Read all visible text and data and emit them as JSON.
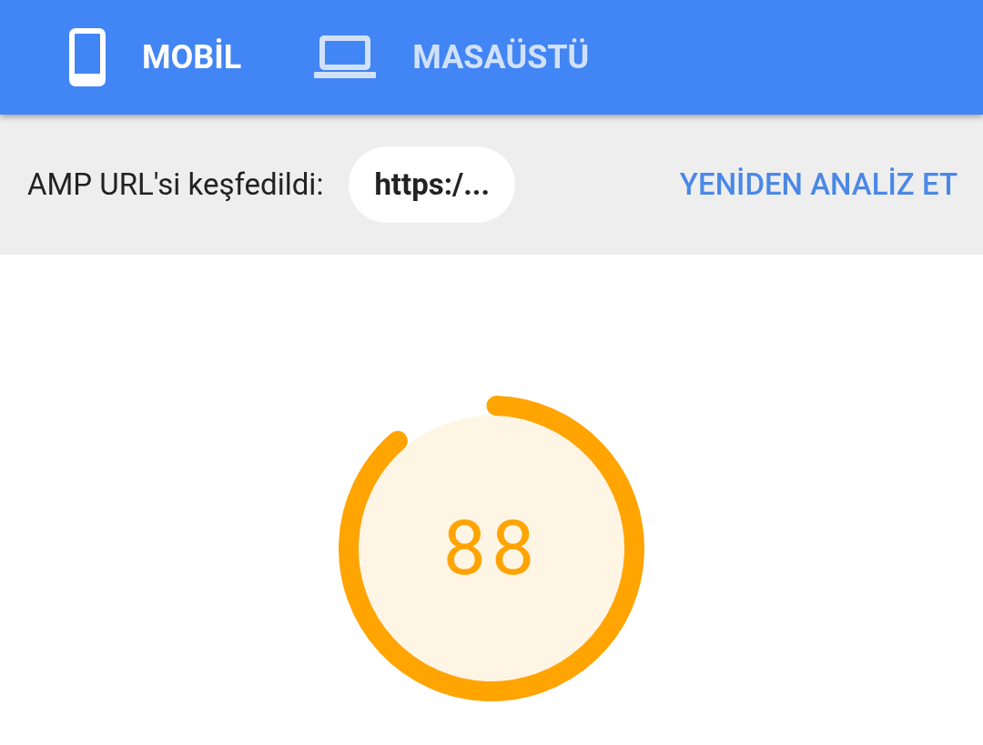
{
  "tabs": [
    {
      "label": "MOBİL",
      "kind": "phone",
      "selected": true
    },
    {
      "label": "MASAÜSTÜ",
      "kind": "laptop",
      "selected": false
    }
  ],
  "amp_bar": {
    "label": "AMP URL'si keşfedildi:",
    "url": "https:/...",
    "action": "YENİDEN ANALİZ ET"
  },
  "score": {
    "value": "88",
    "level": 0.88
  }
}
